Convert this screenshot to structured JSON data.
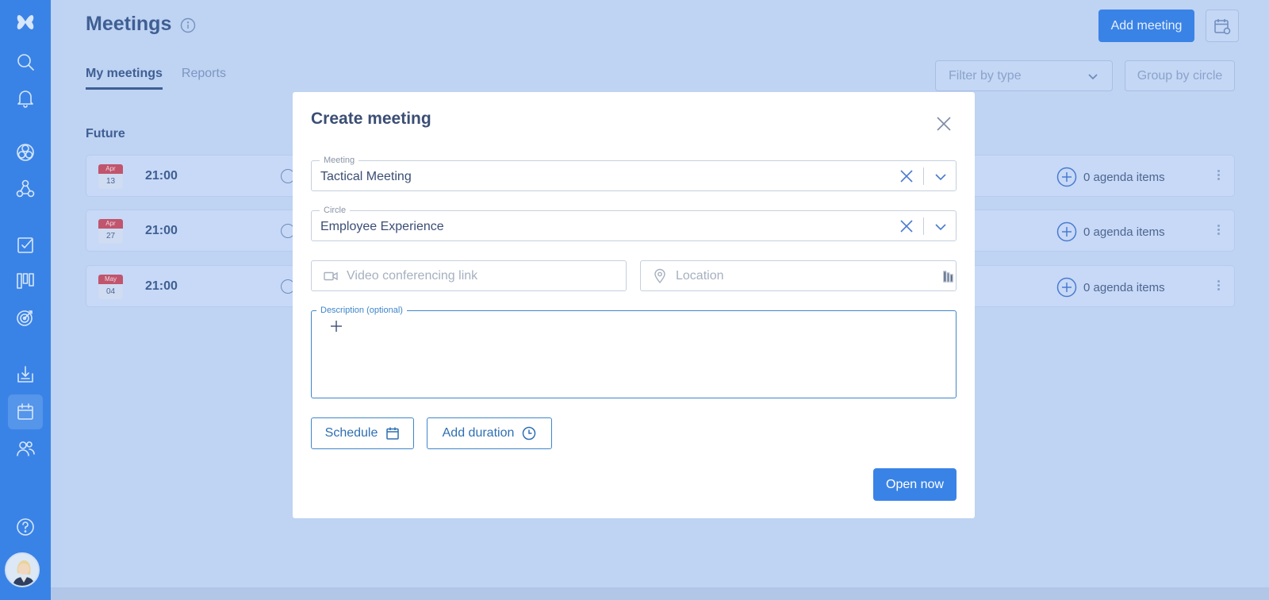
{
  "page": {
    "title": "Meetings",
    "info_icon": "info-icon"
  },
  "header": {
    "add_meeting_label": "Add meeting",
    "calendar_icon": "calendar-sync-icon"
  },
  "tabs": [
    {
      "label": "My meetings",
      "active": true
    },
    {
      "label": "Reports",
      "active": false
    }
  ],
  "filters": {
    "filter_by_type": "Filter by type",
    "group_by_circle": "Group by circle"
  },
  "section": {
    "label": "Future"
  },
  "meetings": [
    {
      "month": "Apr",
      "day": "13",
      "time": "21:00",
      "agenda": "0 agenda items"
    },
    {
      "month": "Apr",
      "day": "27",
      "time": "21:00",
      "agenda": "0 agenda items"
    },
    {
      "month": "May",
      "day": "04",
      "time": "21:00",
      "agenda": "0 agenda items"
    }
  ],
  "sidebar": {
    "icons": [
      "logo-icon",
      "search-icon",
      "bell-icon",
      "circles-icon",
      "roles-icon",
      "checkbox-icon",
      "board-icon",
      "target-icon",
      "inbox-icon",
      "calendar-icon",
      "people-icon",
      "help-icon"
    ],
    "active": "calendar-icon"
  },
  "modal": {
    "title": "Create meeting",
    "meeting_legend": "Meeting",
    "meeting_value": "Tactical Meeting",
    "circle_legend": "Circle",
    "circle_value": "Employee Experience",
    "video_placeholder": "Video conferencing link",
    "location_placeholder": "Location",
    "description_legend": "Description (optional)",
    "schedule_label": "Schedule",
    "add_duration_label": "Add duration",
    "open_now_label": "Open now"
  },
  "colors": {
    "accent": "#3a83e6",
    "background": "#bfd3f3",
    "date_badge": "#c0556d"
  }
}
